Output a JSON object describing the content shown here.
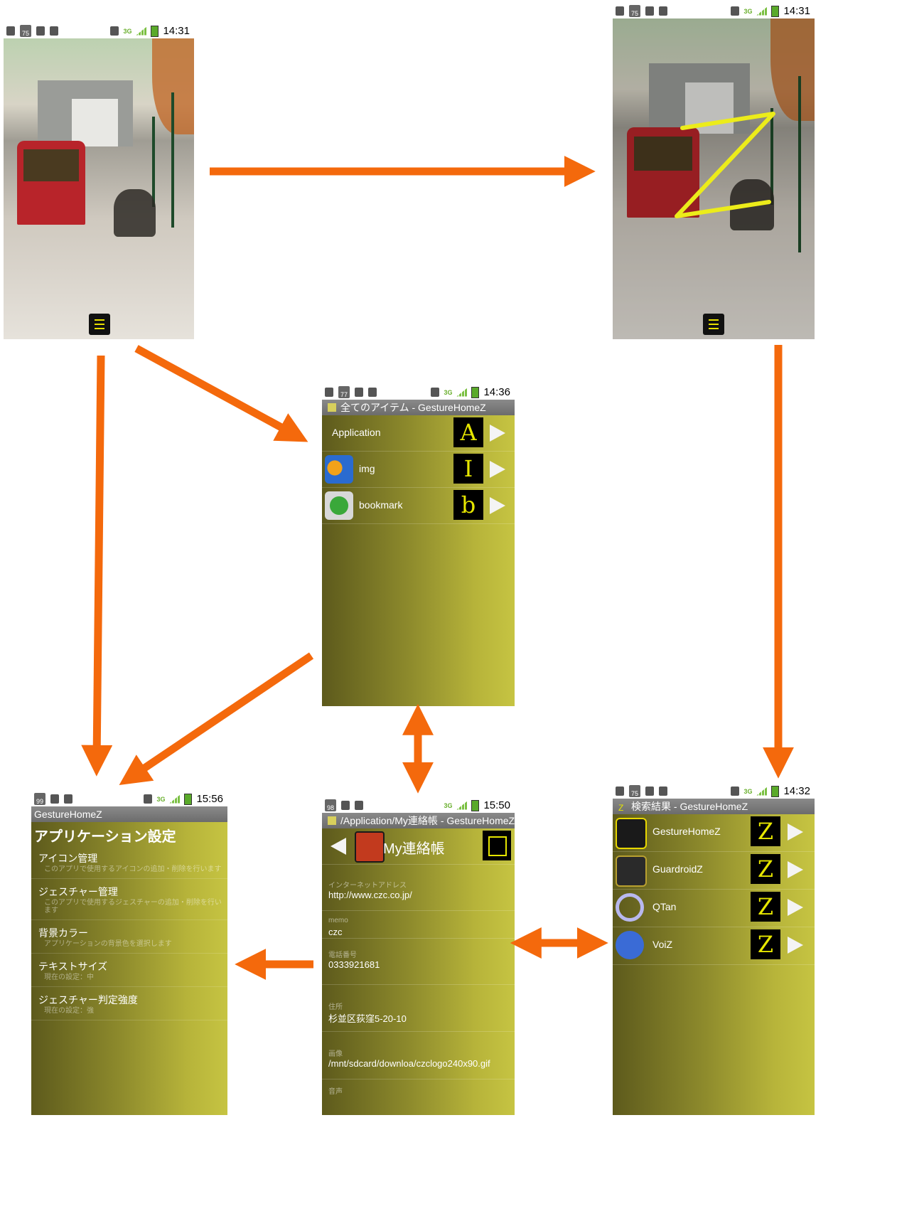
{
  "colors": {
    "accent_arrow": "#f4690c",
    "app_bg_light": "#c6c442",
    "app_bg_dark": "#5d5a1c",
    "gesture_yellow": "#ecec1a"
  },
  "home1": {
    "status_time": "14:31",
    "cal_badge": "75"
  },
  "home2": {
    "status_time": "14:31",
    "cal_badge": "75",
    "gesture_letter": "Z"
  },
  "all_items": {
    "status_time": "14:36",
    "cal_badge": "77",
    "title": "全てのアイテム - GestureHomeZ",
    "rows": [
      {
        "label": "Application",
        "gesture": "A",
        "icon": "none"
      },
      {
        "label": "img",
        "gesture": "I",
        "icon": "sunflower-icon"
      },
      {
        "label": "bookmark",
        "gesture": "b",
        "icon": "globe-icon"
      }
    ]
  },
  "settings": {
    "status_time": "15:56",
    "cal_badge": "99",
    "title": "GestureHomeZ",
    "heading": "アプリケーション設定",
    "items": [
      {
        "title": "アイコン管理",
        "sub": "このアプリで使用するアイコンの追加・削除を行います"
      },
      {
        "title": "ジェスチャー管理",
        "sub": "このアプリで使用するジェスチャーの追加・削除を行います"
      },
      {
        "title": "背景カラー",
        "sub": "アプリケーションの背景色を選択します"
      },
      {
        "title": "テキストサイズ",
        "sub": "現在の設定：中"
      },
      {
        "title": "ジェスチャー判定強度",
        "sub": "現在の設定：強"
      }
    ]
  },
  "contact": {
    "status_time": "15:50",
    "cal_badge": "98",
    "title": "/Application/My連絡帳 - GestureHomeZ",
    "header_label": "My連絡帳",
    "fields": [
      {
        "label": "インターネットアドレス",
        "value": "http://www.czc.co.jp/"
      },
      {
        "label": "memo",
        "value": "czc"
      },
      {
        "label": "電話番号",
        "value": "0333921681"
      },
      {
        "label": "住所",
        "value": "杉並区荻窪5-20-10"
      },
      {
        "label": "画像",
        "value": "/mnt/sdcard/downloa/czclogo240x90.gif"
      },
      {
        "label": "音声",
        "value": ""
      }
    ]
  },
  "search": {
    "status_time": "14:32",
    "cal_badge": "75",
    "title": "検索結果 - GestureHomeZ",
    "rows": [
      {
        "label": "GestureHomeZ",
        "gesture": "Z",
        "icon": "home-icon"
      },
      {
        "label": "GuardroidZ",
        "gesture": "Z",
        "icon": "contact-book-icon"
      },
      {
        "label": "QTan",
        "gesture": "Z",
        "icon": "q-icon"
      },
      {
        "label": "VoiZ",
        "gesture": "Z",
        "icon": "microphone-icon"
      }
    ]
  }
}
